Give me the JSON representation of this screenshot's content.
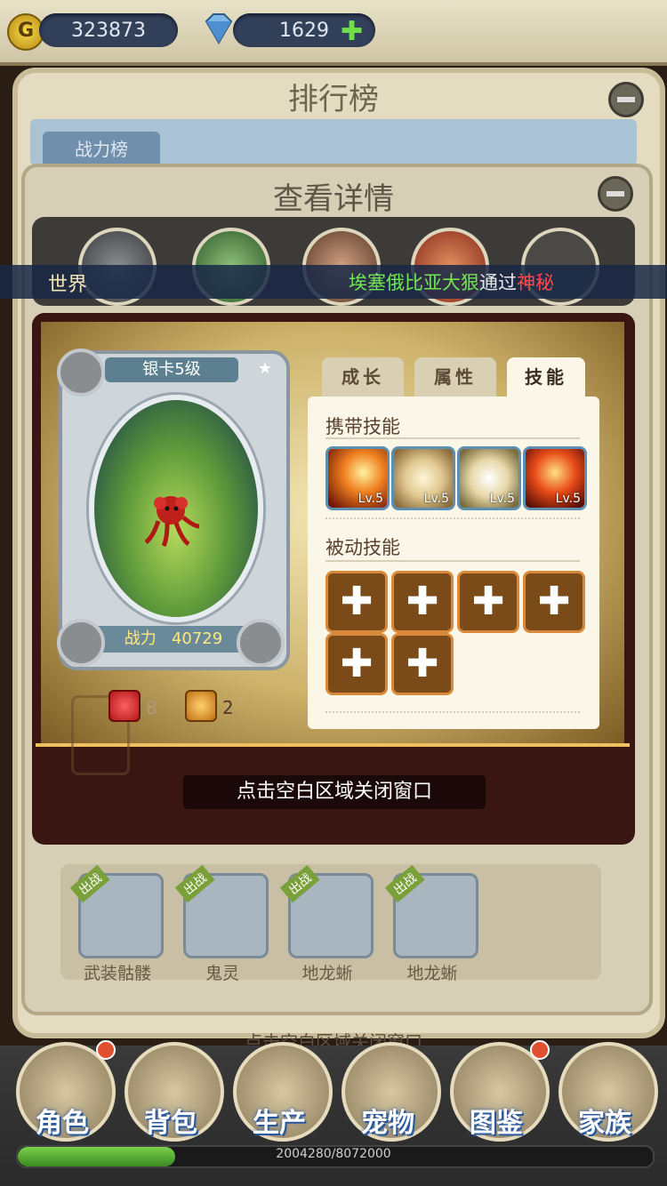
{
  "currency": {
    "gold": "323873",
    "diamonds": "1629",
    "coin_icon": "gold-coin-icon",
    "diamond_icon": "diamond-icon",
    "add_icon": "plus-icon"
  },
  "leaderboard": {
    "title": "排行榜",
    "tab_label": "战力榜"
  },
  "detail": {
    "title": "查看详情",
    "close_hint": "点击空白区域关闭窗口"
  },
  "chat": {
    "channel": "世界",
    "message_parts": [
      {
        "text": "埃塞俄比亚大狠",
        "color": "#72e650"
      },
      {
        "text": "通过",
        "color": "#e8e8e8"
      },
      {
        "text": "神秘",
        "color": "#ff4a4a"
      }
    ]
  },
  "card": {
    "rank_label": "银卡5级",
    "power_label": "战力",
    "power_value": "40729"
  },
  "gems": {
    "red_count": "8",
    "orange_count": "2"
  },
  "tabs": [
    {
      "label": "成长",
      "active": false
    },
    {
      "label": "属性",
      "active": false
    },
    {
      "label": "技能",
      "active": true
    }
  ],
  "skills": {
    "carried_title": "携带技能",
    "carried": [
      {
        "icon": "fire-strike-icon",
        "level": "Lv.5"
      },
      {
        "icon": "whirlwind-icon",
        "level": "Lv.5"
      },
      {
        "icon": "tornado-icon",
        "level": "Lv.5"
      },
      {
        "icon": "flame-burst-icon",
        "level": "Lv.5"
      }
    ],
    "passive_title": "被动技能",
    "passive_slots": 6
  },
  "team": [
    {
      "name": "武装骷髅",
      "badge": "出战"
    },
    {
      "name": "鬼灵",
      "badge": "出战"
    },
    {
      "name": "地龙蜥",
      "badge": "出战"
    },
    {
      "name": "地龙蜥",
      "badge": "出战"
    }
  ],
  "nav": [
    {
      "label": "角色",
      "icon": "character-icon",
      "dot": true
    },
    {
      "label": "背包",
      "icon": "backpack-icon",
      "dot": false
    },
    {
      "label": "生产",
      "icon": "pickaxe-icon",
      "dot": false
    },
    {
      "label": "宠物",
      "icon": "pet-icon",
      "dot": false
    },
    {
      "label": "图鉴",
      "icon": "book-icon",
      "dot": true
    },
    {
      "label": "家族",
      "icon": "guild-icon",
      "dot": false
    }
  ],
  "experience": {
    "text": "2004280/8072000",
    "fraction": 0.2483
  },
  "colors": {
    "gold_panel": "#cdb26a",
    "dark_panel": "#3a1612",
    "skill_panel": "#fbf7e8"
  }
}
